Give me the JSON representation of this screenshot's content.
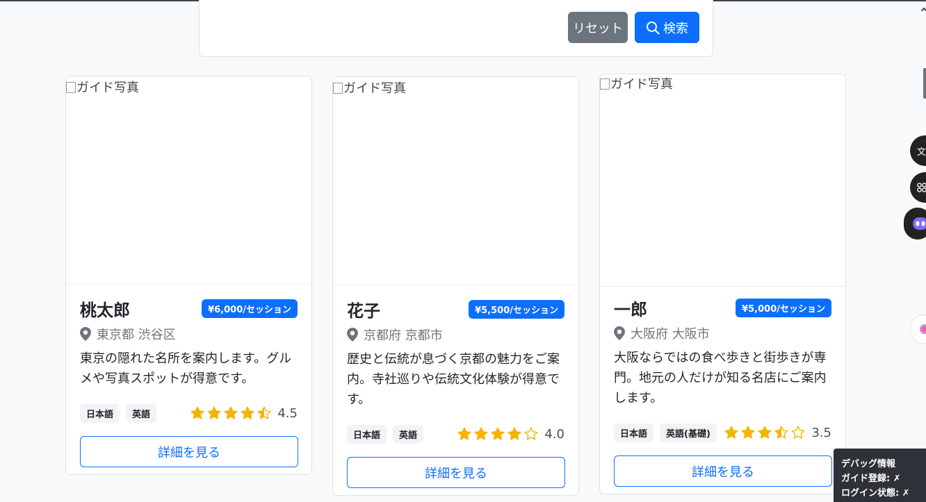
{
  "search": {
    "reset_label": "リセット",
    "search_label": "検索"
  },
  "cards": [
    {
      "image_alt": "ガイド写真",
      "name": "桃太郎",
      "price": "¥6,000/セッション",
      "location": "東京都 渋谷区",
      "description": "東京の隠れた名所を案内します。グルメや写真スポットが得意です。",
      "languages": [
        "日本語",
        "英語"
      ],
      "rating": 4.5,
      "rating_text": "4.5",
      "detail_label": "詳細を見る"
    },
    {
      "image_alt": "ガイド写真",
      "name": "花子",
      "price": "¥5,500/セッション",
      "location": "京都府 京都市",
      "description": "歴史と伝統が息づく京都の魅力をご案内。寺社巡りや伝統文化体験が得意です。",
      "languages": [
        "日本語",
        "英語"
      ],
      "rating": 4.0,
      "rating_text": "4.0",
      "detail_label": "詳細を見る"
    },
    {
      "image_alt": "ガイド写真",
      "name": "一郎",
      "price": "¥5,000/セッション",
      "location": "大阪府 大阪市",
      "description": "大阪ならではの食べ歩きと街歩きが専門。地元の人だけが知る名店にご案内します。",
      "languages": [
        "日本語",
        "英語(基礎)"
      ],
      "rating": 3.5,
      "rating_text": "3.5",
      "detail_label": "詳細を見る"
    }
  ],
  "side_widgets": {
    "translate_label": "文"
  },
  "debug": {
    "title": "デバッグ情報",
    "guide_registration": "ガイド登録: ✗",
    "login_status": "ログイン状態: ✗"
  },
  "colors": {
    "primary": "#0d6efd",
    "secondary": "#6c757d",
    "star": "#f5b400"
  }
}
